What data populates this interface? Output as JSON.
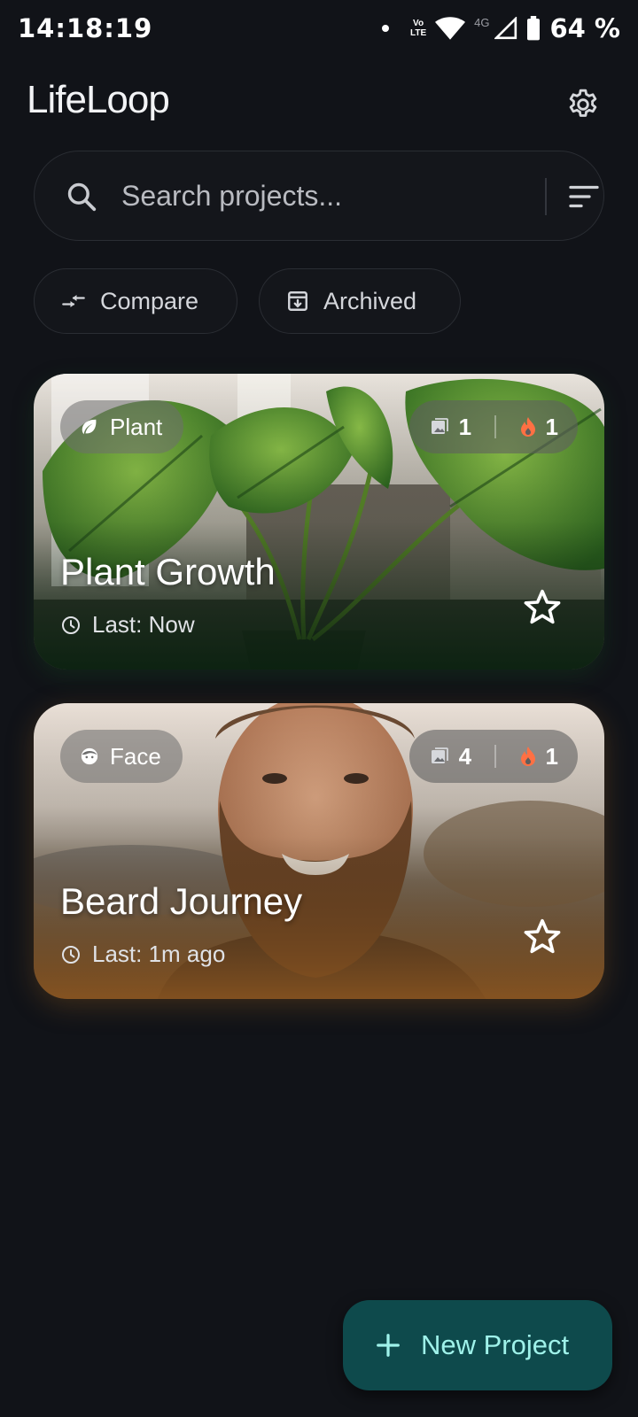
{
  "status_bar": {
    "time": "14:18:19",
    "volte_top": "Vo",
    "volte_bottom": "LTE",
    "network": "4G",
    "battery": "64 %"
  },
  "header": {
    "title": "LifeLoop",
    "settings_icon": "gear-icon"
  },
  "search": {
    "placeholder": "Search projects...",
    "value": ""
  },
  "chips": [
    {
      "label": "Compare",
      "icon": "compare-arrows-icon"
    },
    {
      "label": "Archived",
      "icon": "archive-icon"
    }
  ],
  "projects": [
    {
      "category": "Plant",
      "category_icon": "leaf-icon",
      "photos": "1",
      "streak": "1",
      "title": "Plant Growth",
      "last": "Last: Now",
      "starred": false
    },
    {
      "category": "Face",
      "category_icon": "face-icon",
      "photos": "4",
      "streak": "1",
      "title": "Beard Journey",
      "last": "Last: 1m ago",
      "starred": false
    }
  ],
  "fab": {
    "label": "New Project",
    "icon": "plus-icon"
  },
  "colors": {
    "background": "#111318",
    "fab": "#0e4a4c",
    "fab_text": "#9ff2ea",
    "streak": "#ff7043"
  }
}
